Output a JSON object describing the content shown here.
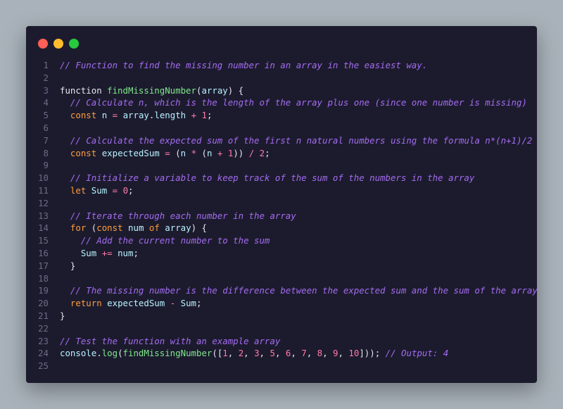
{
  "window": {
    "controls": {
      "close_color": "#ff5f56",
      "minimize_color": "#ffbd2e",
      "maximize_color": "#27c93f"
    }
  },
  "code": {
    "language": "javascript",
    "lines": [
      {
        "n": "1",
        "tokens": [
          {
            "t": "comment",
            "v": "// Function to find the missing number in an array in the easiest way."
          }
        ]
      },
      {
        "n": "2",
        "tokens": []
      },
      {
        "n": "3",
        "tokens": [
          {
            "t": "plain",
            "v": "function "
          },
          {
            "t": "fn",
            "v": "findMissingNumber"
          },
          {
            "t": "punc",
            "v": "("
          },
          {
            "t": "var",
            "v": "array"
          },
          {
            "t": "punc",
            "v": ") {"
          }
        ]
      },
      {
        "n": "4",
        "tokens": [
          {
            "t": "plain",
            "v": "  "
          },
          {
            "t": "comment",
            "v": "// Calculate n, which is the length of the array plus one (since one number is missing)"
          }
        ]
      },
      {
        "n": "5",
        "tokens": [
          {
            "t": "plain",
            "v": "  "
          },
          {
            "t": "kw",
            "v": "const"
          },
          {
            "t": "plain",
            "v": " "
          },
          {
            "t": "var",
            "v": "n"
          },
          {
            "t": "plain",
            "v": " "
          },
          {
            "t": "op",
            "v": "="
          },
          {
            "t": "plain",
            "v": " "
          },
          {
            "t": "var",
            "v": "array"
          },
          {
            "t": "punc",
            "v": "."
          },
          {
            "t": "var",
            "v": "length"
          },
          {
            "t": "plain",
            "v": " "
          },
          {
            "t": "op",
            "v": "+"
          },
          {
            "t": "plain",
            "v": " "
          },
          {
            "t": "num",
            "v": "1"
          },
          {
            "t": "punc",
            "v": ";"
          }
        ]
      },
      {
        "n": "6",
        "tokens": []
      },
      {
        "n": "7",
        "tokens": [
          {
            "t": "plain",
            "v": "  "
          },
          {
            "t": "comment",
            "v": "// Calculate the expected sum of the first n natural numbers using the formula n*(n+1)/2"
          }
        ]
      },
      {
        "n": "8",
        "tokens": [
          {
            "t": "plain",
            "v": "  "
          },
          {
            "t": "kw",
            "v": "const"
          },
          {
            "t": "plain",
            "v": " "
          },
          {
            "t": "var",
            "v": "expectedSum"
          },
          {
            "t": "plain",
            "v": " "
          },
          {
            "t": "op",
            "v": "="
          },
          {
            "t": "plain",
            "v": " "
          },
          {
            "t": "punc",
            "v": "("
          },
          {
            "t": "var",
            "v": "n"
          },
          {
            "t": "plain",
            "v": " "
          },
          {
            "t": "op",
            "v": "*"
          },
          {
            "t": "plain",
            "v": " "
          },
          {
            "t": "punc",
            "v": "("
          },
          {
            "t": "var",
            "v": "n"
          },
          {
            "t": "plain",
            "v": " "
          },
          {
            "t": "op",
            "v": "+"
          },
          {
            "t": "plain",
            "v": " "
          },
          {
            "t": "num",
            "v": "1"
          },
          {
            "t": "punc",
            "v": ")) "
          },
          {
            "t": "op",
            "v": "/"
          },
          {
            "t": "plain",
            "v": " "
          },
          {
            "t": "num",
            "v": "2"
          },
          {
            "t": "punc",
            "v": ";"
          }
        ]
      },
      {
        "n": "9",
        "tokens": []
      },
      {
        "n": "10",
        "tokens": [
          {
            "t": "plain",
            "v": "  "
          },
          {
            "t": "comment",
            "v": "// Initialize a variable to keep track of the sum of the numbers in the array"
          }
        ]
      },
      {
        "n": "11",
        "tokens": [
          {
            "t": "plain",
            "v": "  "
          },
          {
            "t": "kw",
            "v": "let"
          },
          {
            "t": "plain",
            "v": " "
          },
          {
            "t": "var",
            "v": "Sum"
          },
          {
            "t": "plain",
            "v": " "
          },
          {
            "t": "op",
            "v": "="
          },
          {
            "t": "plain",
            "v": " "
          },
          {
            "t": "num",
            "v": "0"
          },
          {
            "t": "punc",
            "v": ";"
          }
        ]
      },
      {
        "n": "12",
        "tokens": []
      },
      {
        "n": "13",
        "tokens": [
          {
            "t": "plain",
            "v": "  "
          },
          {
            "t": "comment",
            "v": "// Iterate through each number in the array"
          }
        ]
      },
      {
        "n": "14",
        "tokens": [
          {
            "t": "plain",
            "v": "  "
          },
          {
            "t": "kw",
            "v": "for"
          },
          {
            "t": "plain",
            "v": " "
          },
          {
            "t": "punc",
            "v": "("
          },
          {
            "t": "kw",
            "v": "const"
          },
          {
            "t": "plain",
            "v": " "
          },
          {
            "t": "var",
            "v": "num"
          },
          {
            "t": "plain",
            "v": " "
          },
          {
            "t": "kw",
            "v": "of"
          },
          {
            "t": "plain",
            "v": " "
          },
          {
            "t": "var",
            "v": "array"
          },
          {
            "t": "punc",
            "v": ") {"
          }
        ]
      },
      {
        "n": "15",
        "tokens": [
          {
            "t": "plain",
            "v": "    "
          },
          {
            "t": "comment",
            "v": "// Add the current number to the sum"
          }
        ]
      },
      {
        "n": "16",
        "tokens": [
          {
            "t": "plain",
            "v": "    "
          },
          {
            "t": "var",
            "v": "Sum"
          },
          {
            "t": "plain",
            "v": " "
          },
          {
            "t": "op",
            "v": "+="
          },
          {
            "t": "plain",
            "v": " "
          },
          {
            "t": "var",
            "v": "num"
          },
          {
            "t": "punc",
            "v": ";"
          }
        ]
      },
      {
        "n": "17",
        "tokens": [
          {
            "t": "plain",
            "v": "  "
          },
          {
            "t": "punc",
            "v": "}"
          }
        ]
      },
      {
        "n": "18",
        "tokens": []
      },
      {
        "n": "19",
        "tokens": [
          {
            "t": "plain",
            "v": "  "
          },
          {
            "t": "comment",
            "v": "// The missing number is the difference between the expected sum and the sum of the array"
          }
        ]
      },
      {
        "n": "20",
        "tokens": [
          {
            "t": "plain",
            "v": "  "
          },
          {
            "t": "kw",
            "v": "return"
          },
          {
            "t": "plain",
            "v": " "
          },
          {
            "t": "var",
            "v": "expectedSum"
          },
          {
            "t": "plain",
            "v": " "
          },
          {
            "t": "op",
            "v": "-"
          },
          {
            "t": "plain",
            "v": " "
          },
          {
            "t": "var",
            "v": "Sum"
          },
          {
            "t": "punc",
            "v": ";"
          }
        ]
      },
      {
        "n": "21",
        "tokens": [
          {
            "t": "punc",
            "v": "}"
          }
        ]
      },
      {
        "n": "22",
        "tokens": []
      },
      {
        "n": "23",
        "tokens": [
          {
            "t": "comment",
            "v": "// Test the function with an example array"
          }
        ]
      },
      {
        "n": "24",
        "tokens": [
          {
            "t": "var",
            "v": "console"
          },
          {
            "t": "punc",
            "v": "."
          },
          {
            "t": "fn",
            "v": "log"
          },
          {
            "t": "punc",
            "v": "("
          },
          {
            "t": "fn",
            "v": "findMissingNumber"
          },
          {
            "t": "punc",
            "v": "(["
          },
          {
            "t": "num",
            "v": "1"
          },
          {
            "t": "punc",
            "v": ", "
          },
          {
            "t": "num",
            "v": "2"
          },
          {
            "t": "punc",
            "v": ", "
          },
          {
            "t": "num",
            "v": "3"
          },
          {
            "t": "punc",
            "v": ", "
          },
          {
            "t": "num",
            "v": "5"
          },
          {
            "t": "punc",
            "v": ", "
          },
          {
            "t": "num",
            "v": "6"
          },
          {
            "t": "punc",
            "v": ", "
          },
          {
            "t": "num",
            "v": "7"
          },
          {
            "t": "punc",
            "v": ", "
          },
          {
            "t": "num",
            "v": "8"
          },
          {
            "t": "punc",
            "v": ", "
          },
          {
            "t": "num",
            "v": "9"
          },
          {
            "t": "punc",
            "v": ", "
          },
          {
            "t": "num",
            "v": "10"
          },
          {
            "t": "punc",
            "v": "])); "
          },
          {
            "t": "comment",
            "v": "// Output: 4"
          }
        ]
      },
      {
        "n": "25",
        "tokens": []
      }
    ]
  }
}
